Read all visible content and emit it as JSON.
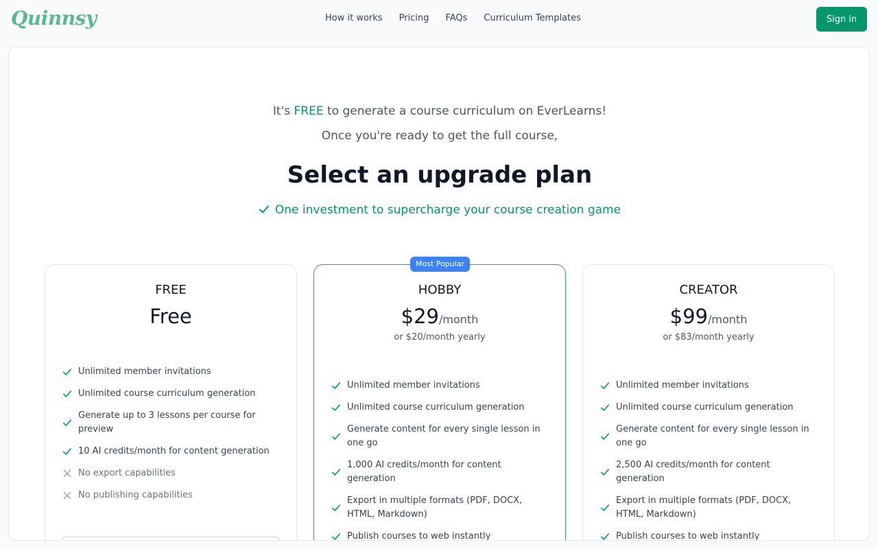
{
  "header": {
    "logo": "Quinnsy",
    "nav": [
      "How it works",
      "Pricing",
      "FAQs",
      "Curriculum Templates"
    ],
    "signin": "Sign in"
  },
  "hero": {
    "intro_prefix": "It's ",
    "intro_free": "FREE",
    "intro_suffix": " to generate a course curriculum on EverLearns!",
    "intro2": "Once you're ready to get the full course,",
    "headline": "Select an upgrade plan",
    "tagline": "One investment to supercharge your course creation game"
  },
  "colors": {
    "accent": "#059669",
    "popular": "#3b82f6"
  },
  "plans": [
    {
      "name": "FREE",
      "price": "Free",
      "per": "",
      "yearly": "",
      "badge": "",
      "features": [
        {
          "text": "Unlimited member invitations",
          "included": true
        },
        {
          "text": "Unlimited course curriculum generation",
          "included": true
        },
        {
          "text": "Generate up to 3 lessons per course for preview",
          "included": true
        },
        {
          "text": "10 AI credits/month for content generation",
          "included": true
        },
        {
          "text": "No export capabilities",
          "included": false
        },
        {
          "text": "No publishing capabilities",
          "included": false
        }
      ]
    },
    {
      "name": "HOBBY",
      "price": "$29",
      "per": "/month",
      "yearly": "or $20/month yearly",
      "badge": "Most Popular",
      "features": [
        {
          "text": "Unlimited member invitations",
          "included": true
        },
        {
          "text": "Unlimited course curriculum generation",
          "included": true
        },
        {
          "text": "Generate content for every single lesson in one go",
          "included": true
        },
        {
          "text": "1,000 AI credits/month for content generation",
          "included": true
        },
        {
          "text": "Export in multiple formats (PDF, DOCX, HTML, Markdown)",
          "included": true
        },
        {
          "text": "Publish courses to web instantly",
          "included": true
        }
      ]
    },
    {
      "name": "CREATOR",
      "price": "$99",
      "per": "/month",
      "yearly": "or $83/month yearly",
      "badge": "",
      "features": [
        {
          "text": "Unlimited member invitations",
          "included": true
        },
        {
          "text": "Unlimited course curriculum generation",
          "included": true
        },
        {
          "text": "Generate content for every single lesson in one go",
          "included": true
        },
        {
          "text": "2,500 AI credits/month for content generation",
          "included": true
        },
        {
          "text": "Export in multiple formats (PDF, DOCX, HTML, Markdown)",
          "included": true
        },
        {
          "text": "Publish courses to web instantly",
          "included": true
        }
      ]
    }
  ]
}
